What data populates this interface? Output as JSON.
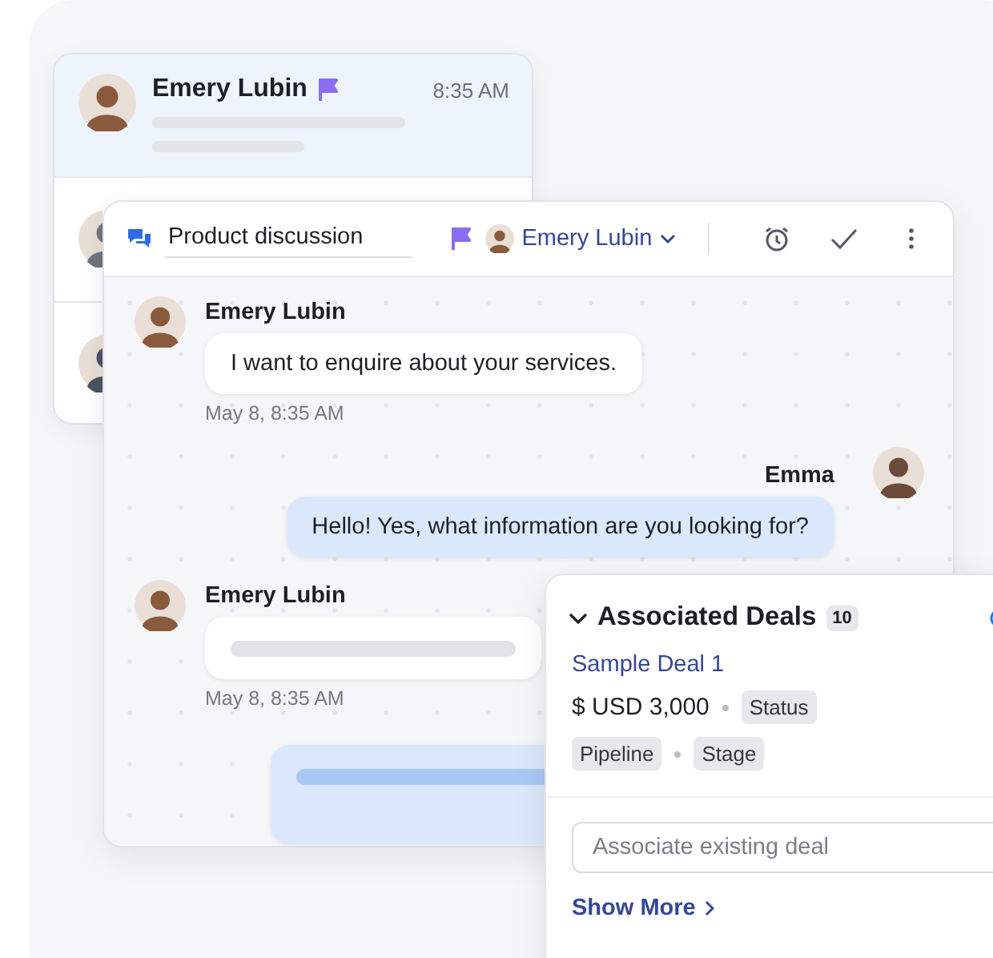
{
  "conversation_list": {
    "items": [
      {
        "selected": true,
        "name": "Emery Lubin",
        "time": "8:35 AM"
      },
      {
        "selected": false
      },
      {
        "selected": false
      }
    ]
  },
  "chat": {
    "title": "Product discussion",
    "assignee": "Emery Lubin",
    "messages": [
      {
        "outgoing": false,
        "kind": "text",
        "sender": "Emery Lubin",
        "text": "I want to enquire about your services.",
        "time": "May 8, 8:35 AM"
      },
      {
        "outgoing": true,
        "kind": "text",
        "sender": "Emma",
        "text": "Hello! Yes, what information are you looking for?"
      },
      {
        "outgoing": false,
        "kind": "skeleton",
        "sender": "Emery Lubin",
        "time": "May 8, 8:35 AM"
      },
      {
        "outgoing": true,
        "kind": "skeleton"
      }
    ]
  },
  "deals_panel": {
    "title": "Associated Deals",
    "count": "10",
    "expanded": true,
    "deals": [
      {
        "name": "Sample Deal 1",
        "amount": "$ USD 3,000",
        "status": "Status",
        "pipeline": "Pipeline",
        "stage": "Stage"
      }
    ],
    "search": {
      "placeholder": "Associate existing deal"
    },
    "show_more": "Show More"
  }
}
